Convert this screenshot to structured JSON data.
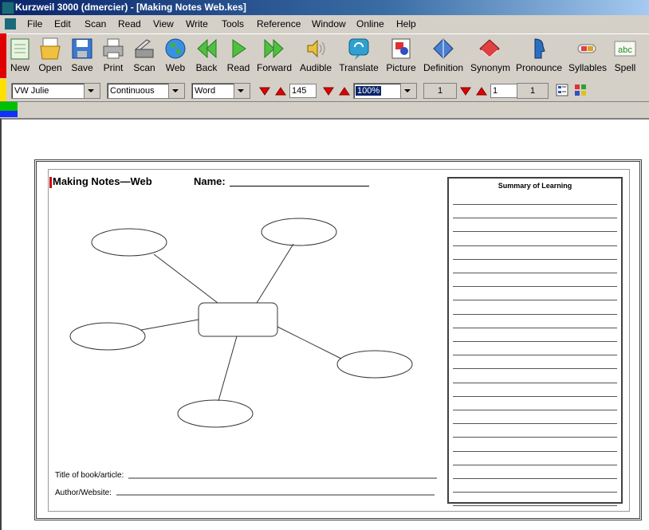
{
  "window": {
    "title": "Kurzweil 3000 (dmercier) - [Making Notes Web.kes]"
  },
  "menu": [
    "File",
    "Edit",
    "Scan",
    "Read",
    "View",
    "Write",
    "Tools",
    "Reference",
    "Window",
    "Online",
    "Help"
  ],
  "toolbar": [
    "New",
    "Open",
    "Save",
    "Print",
    "Scan",
    "Web",
    "Back",
    "Read",
    "Forward",
    "Audible",
    "Translate",
    "Picture",
    "Definition",
    "Synonym",
    "Pronounce",
    "Syllables",
    "Spell"
  ],
  "format_bar": {
    "voice": "VW Julie",
    "reading_mode": "Continuous",
    "reading_unit": "Word",
    "speed": "145",
    "zoom": "100%",
    "page_left": "1",
    "page_input": "1",
    "page_right": "1"
  },
  "document": {
    "title": "Making Notes—Web",
    "name_label": "Name:",
    "summary_title": "Summary of Learning",
    "title_field_label": "Title of book/article:",
    "author_field_label": "Author/Website:"
  },
  "colors": {
    "titlebar": "#0a246a",
    "accent_red": "#d00000"
  }
}
